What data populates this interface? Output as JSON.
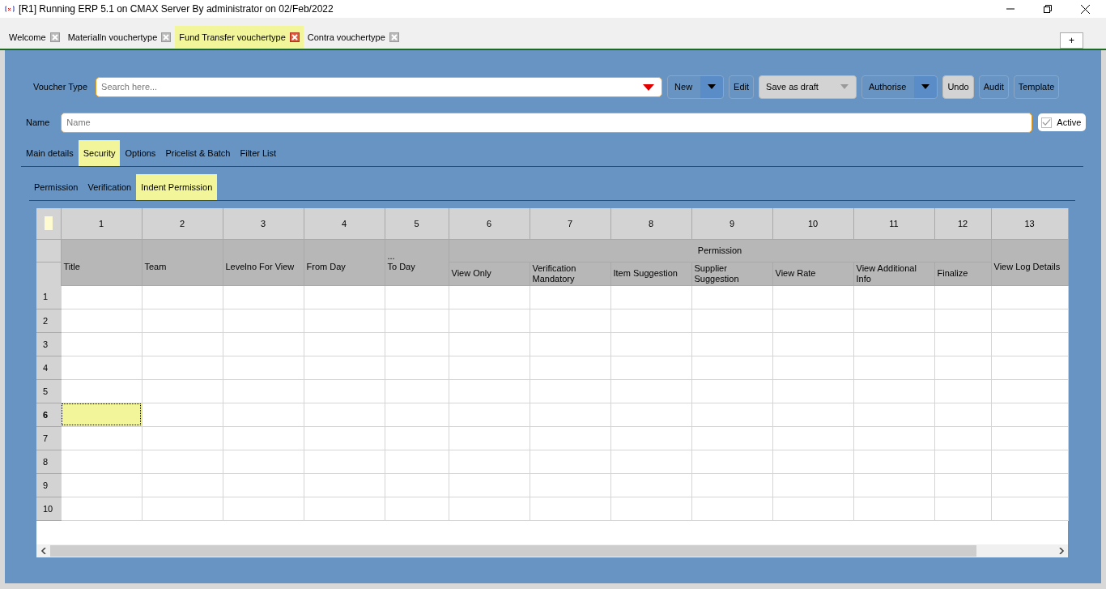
{
  "window": {
    "title": "[R1] Running ERP 5.1 on CMAX Server By administrator on 02/Feb/2022"
  },
  "tabs": [
    {
      "label": "Welcome",
      "selected": false
    },
    {
      "label": "Materialln vouchertype",
      "selected": false
    },
    {
      "label": "Fund Transfer vouchertype",
      "selected": true
    },
    {
      "label": "Contra vouchertype",
      "selected": false
    }
  ],
  "add_tab": "+",
  "voucher_type": {
    "label": "Voucher Type",
    "placeholder": "Search here..."
  },
  "buttons": [
    {
      "label": "New",
      "kind": "split",
      "disabled": false
    },
    {
      "label": "Edit",
      "kind": "plain",
      "disabled": false
    },
    {
      "label": "Save as draft",
      "kind": "split",
      "disabled": true
    },
    {
      "label": "Authorise",
      "kind": "split",
      "disabled": false
    },
    {
      "label": "Undo",
      "kind": "plain",
      "disabled": true
    },
    {
      "label": "Audit",
      "kind": "plain",
      "disabled": false
    },
    {
      "label": "Template",
      "kind": "plain",
      "disabled": false
    }
  ],
  "name_field": {
    "label": "Name",
    "placeholder": "Name"
  },
  "active": {
    "label": "Active",
    "checked": true
  },
  "section_tabs": [
    {
      "label": "Main details",
      "selected": false
    },
    {
      "label": "Security",
      "selected": true
    },
    {
      "label": "Options",
      "selected": false
    },
    {
      "label": "Pricelist & Batch",
      "selected": false
    },
    {
      "label": "Filter List",
      "selected": false
    }
  ],
  "sub_tabs": [
    {
      "label": "Permission",
      "selected": false
    },
    {
      "label": "Verification",
      "selected": false
    },
    {
      "label": "Indent Permission",
      "selected": true
    }
  ],
  "table": {
    "group_label": "Permission",
    "columns": [
      {
        "number": "1",
        "label": "Title",
        "grouped": false
      },
      {
        "number": "2",
        "label": "Team",
        "grouped": false
      },
      {
        "number": "3",
        "label": "Levelno For View",
        "grouped": false
      },
      {
        "number": "4",
        "label": "From Day",
        "grouped": false
      },
      {
        "number": "5",
        "label": "...\nTo Day",
        "grouped": false
      },
      {
        "number": "6",
        "label": "View Only",
        "grouped": true
      },
      {
        "number": "7",
        "label": "Verification\nMandatory",
        "grouped": true
      },
      {
        "number": "8",
        "label": "Item Suggestion",
        "grouped": true
      },
      {
        "number": "9",
        "label": "Supplier\nSuggestion",
        "grouped": true
      },
      {
        "number": "10",
        "label": "View Rate",
        "grouped": true
      },
      {
        "number": "11",
        "label": "View Additional\nInfo",
        "grouped": true
      },
      {
        "number": "12",
        "label": "Finalize",
        "grouped": true
      },
      {
        "number": "13",
        "label": "View Log Details",
        "grouped": false
      }
    ],
    "rows": [
      {
        "number": "1",
        "selected": false
      },
      {
        "number": "2",
        "selected": false
      },
      {
        "number": "3",
        "selected": false
      },
      {
        "number": "4",
        "selected": false
      },
      {
        "number": "5",
        "selected": false
      },
      {
        "number": "6",
        "selected": true
      },
      {
        "number": "7",
        "selected": false
      },
      {
        "number": "8",
        "selected": false
      },
      {
        "number": "9",
        "selected": false
      },
      {
        "number": "10",
        "selected": false
      }
    ]
  }
}
